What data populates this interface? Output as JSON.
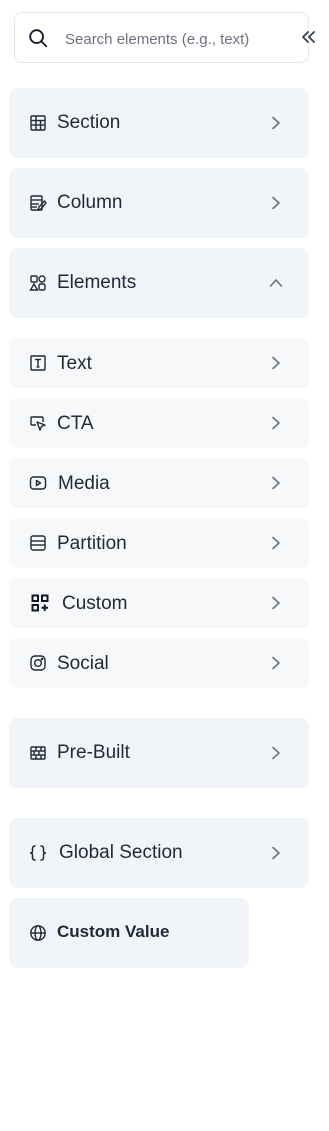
{
  "search": {
    "placeholder": "Search elements (e.g., text)",
    "value": ""
  },
  "collapse": {
    "icon": "double-chevron-left-icon"
  },
  "sections": [
    {
      "label": "Section",
      "icon": "table-icon",
      "state": "collapsed"
    },
    {
      "label": "Column",
      "icon": "column-icon",
      "state": "collapsed"
    },
    {
      "label": "Elements",
      "icon": "shapes-icon",
      "state": "expanded"
    }
  ],
  "elements": [
    {
      "label": "Text",
      "icon": "text-box-icon"
    },
    {
      "label": "CTA",
      "icon": "cursor-click-icon"
    },
    {
      "label": "Media",
      "icon": "play-icon"
    },
    {
      "label": "Partition",
      "icon": "rows-icon"
    },
    {
      "label": "Custom",
      "icon": "grid-plus-icon"
    },
    {
      "label": "Social",
      "icon": "instagram-icon"
    }
  ],
  "prebuilt": {
    "label": "Pre-Built",
    "icon": "bricks-icon"
  },
  "global_section": {
    "label": "Global Section",
    "icon": "braces-icon"
  },
  "custom_value": {
    "label": "Custom Value",
    "icon": "globe-icon"
  }
}
